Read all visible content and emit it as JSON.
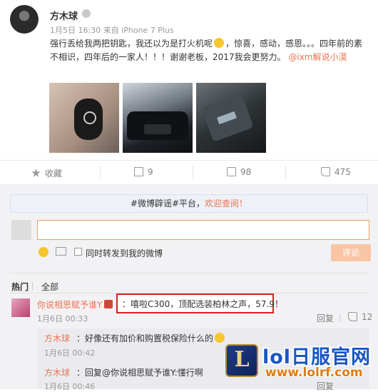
{
  "post": {
    "username": "方木球",
    "meta": "1月5日 16:30 来自 iPhone 7 Plus",
    "text_1": "强行丢给我两把钥匙，我还以为是打火机呢",
    "text_2": "，惊喜，感动，感恩。。。四年前的素不相识，四年后的一家人！！！谢谢老板，2017我会更努力。",
    "mention": "@ixm解说小漠"
  },
  "actions": {
    "favorite_label": "收藏",
    "forward_count": "9",
    "comment_count": "98",
    "like_count": "475"
  },
  "notice": {
    "hashtag": "#微博辟谣#平台，",
    "link": "欢迎查阅！"
  },
  "composer": {
    "input_value": "",
    "repost_checkbox_label": "同时转发到我的微博",
    "submit_label": "评论"
  },
  "tabs": {
    "hot": "热门",
    "all": "全部"
  },
  "comments": [
    {
      "author": "你说相思赋予谁Y",
      "text": "：嘻啦C300，顶配选装柏林之声，57.9！",
      "time": "1月6日 00:33",
      "reply_label": "回复",
      "likes": "12",
      "replies": [
        {
          "author": "方木球",
          "text": "：好像还有加价和购置税保险什么的",
          "time": "1月6日 00:42"
        },
        {
          "author": "方木球",
          "text": "：回复@你说相思赋予谁Y:懂行啊",
          "time": "1月6日 00:46",
          "reply_label": "回复"
        }
      ]
    }
  ],
  "watermark": {
    "logo_letter": "L",
    "title": "lol日服官网",
    "url": "www.lolrf.com"
  },
  "colors": {
    "accent": "#eb7350",
    "highlight_border": "#d8201f",
    "watermark_blue": "#1a56c4"
  }
}
